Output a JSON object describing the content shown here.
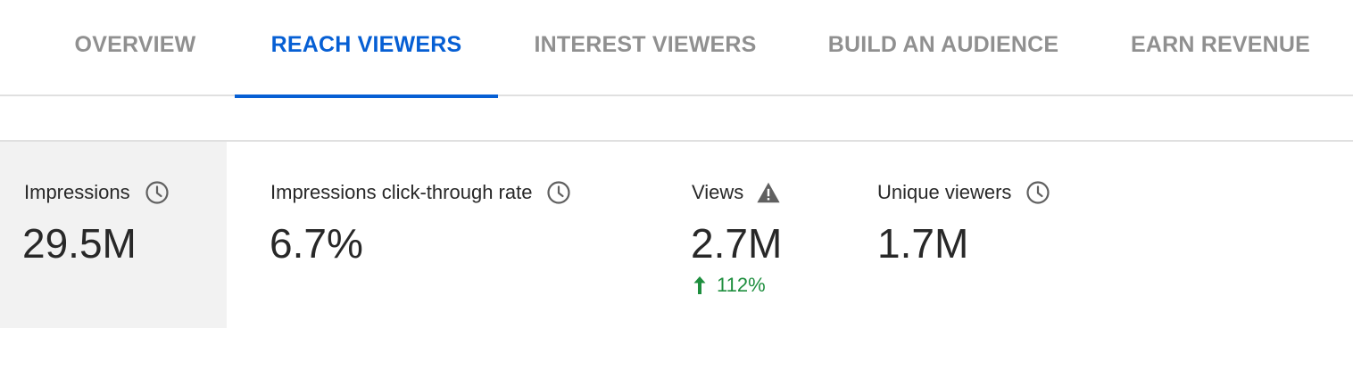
{
  "tabs": [
    {
      "label": "OVERVIEW",
      "active": false
    },
    {
      "label": "REACH VIEWERS",
      "active": true
    },
    {
      "label": "INTEREST VIEWERS",
      "active": false
    },
    {
      "label": "BUILD AN AUDIENCE",
      "active": false
    },
    {
      "label": "EARN REVENUE",
      "active": false
    }
  ],
  "metrics": [
    {
      "label": "Impressions",
      "value": "29.5M",
      "icon": "clock-icon",
      "selected": true
    },
    {
      "label": "Impressions click-through rate",
      "value": "6.7%",
      "icon": "clock-icon",
      "selected": false
    },
    {
      "label": "Views",
      "value": "2.7M",
      "icon": "warning-icon",
      "selected": false,
      "change": "112%",
      "change_direction": "up"
    },
    {
      "label": "Unique viewers",
      "value": "1.7M",
      "icon": "clock-icon",
      "selected": false
    }
  ],
  "colors": {
    "accent": "#065fd4",
    "inactive_tab": "#909090",
    "positive": "#1e8e3e",
    "selected_card_bg": "#f2f2f2",
    "icon_gray": "#606060"
  }
}
